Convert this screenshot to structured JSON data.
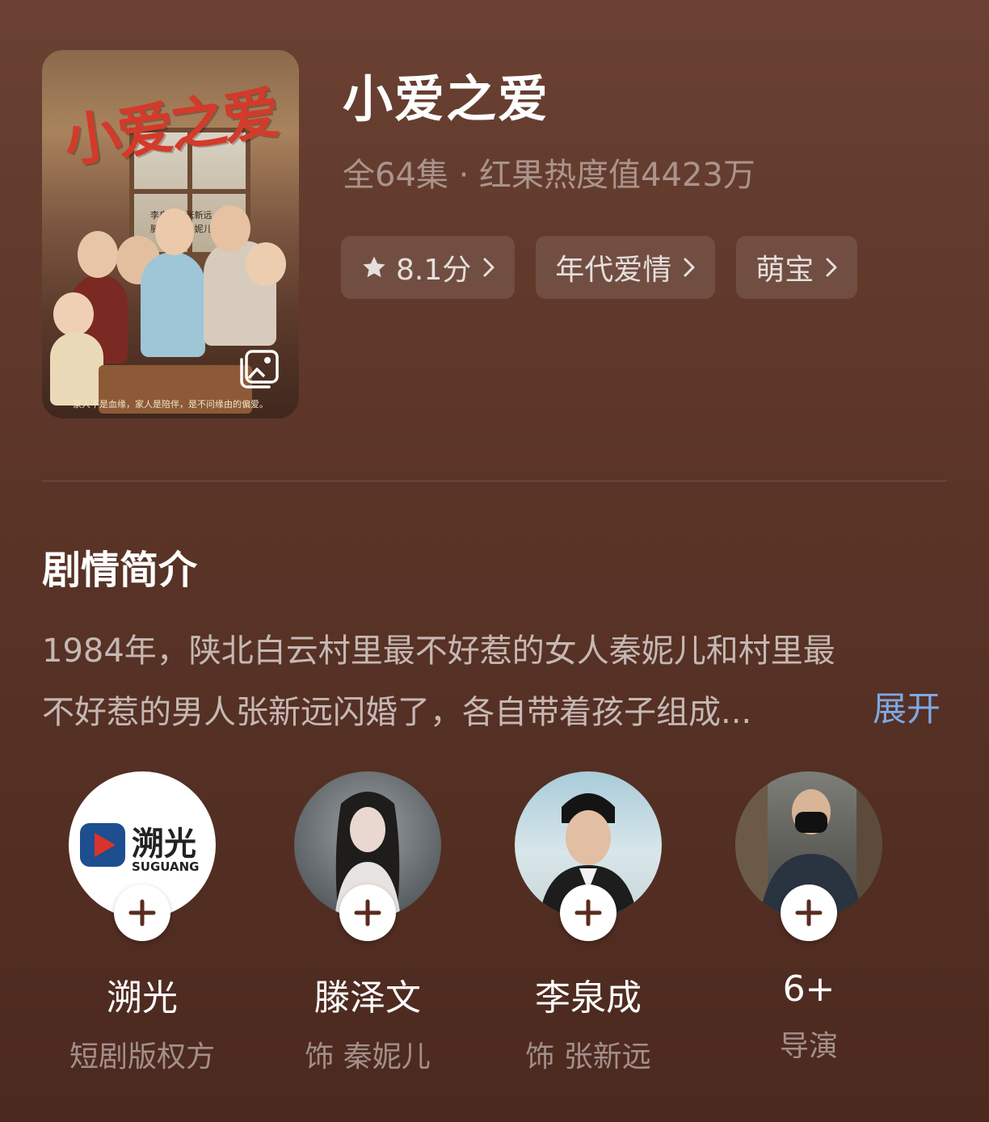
{
  "poster": {
    "title_art": "小爱之爱",
    "credits": [
      "李泉成",
      "张新远",
      "滕泽文",
      "秦妮儿"
    ],
    "tagline": "家人不是血缘，家人是陪伴，是不问缘由的偏爱。",
    "gallery_icon": "image-gallery-icon"
  },
  "header": {
    "title": "小爱之爱",
    "meta": "全64集 · 红果热度值4423万"
  },
  "tags": [
    {
      "label": "8.1分",
      "icon": "star-icon"
    },
    {
      "label": "年代爱情"
    },
    {
      "label": "萌宝"
    }
  ],
  "synopsis": {
    "heading": "剧情简介",
    "line1": "1984年，陕北白云村里最不好惹的女人秦妮儿和村里最",
    "line2": "不好惹的男人张新远闪婚了，各自带着孩子组成...",
    "expand": "展开"
  },
  "people": [
    {
      "name": "溯光",
      "role": "短剧版权方",
      "logo_text": "溯光",
      "logo_sub": "SUGUANG"
    },
    {
      "name": "滕泽文",
      "role": "饰 秦妮儿"
    },
    {
      "name": "李泉成",
      "role": "饰 张新远"
    },
    {
      "name": "6+",
      "role": "导演"
    }
  ],
  "colors": {
    "background": "#5a3427",
    "link": "#7ea8e6",
    "poster_title": "#d33a2a"
  }
}
